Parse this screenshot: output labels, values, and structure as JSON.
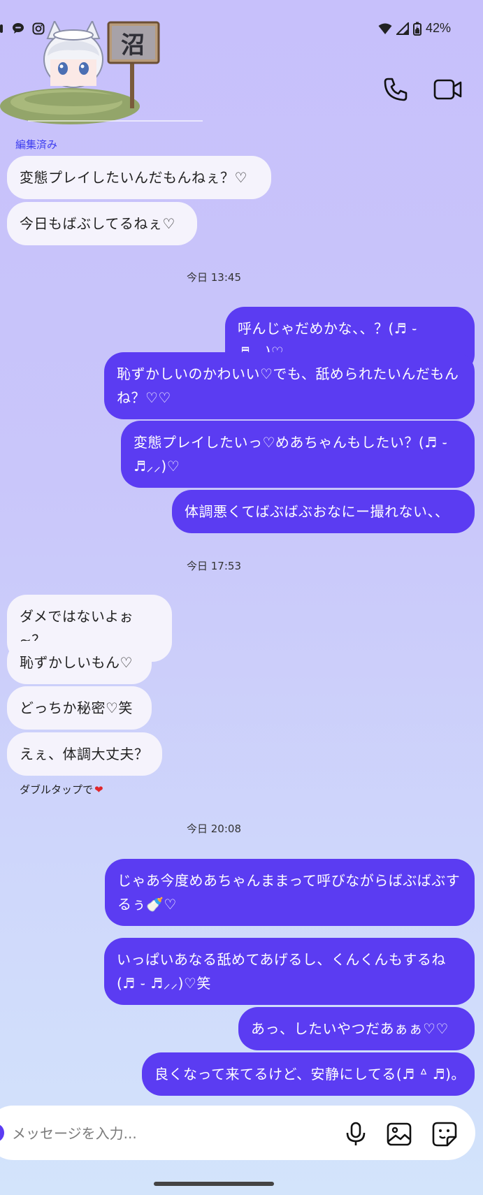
{
  "status_bar": {
    "battery": "42%"
  },
  "header": {
    "sticker_text": "沼"
  },
  "edited_label": "編集済み",
  "messages_block1": [
    {
      "text": "変態プレイしたいんだもんねぇ？♡"
    },
    {
      "text": "今日もばぶしてるねぇ♡"
    }
  ],
  "time1": "今日 13:45",
  "messages_block2": [
    {
      "text": "呼んじゃだめかな、、？(♬︎ ֊ ♬︎⸝⸝)♡"
    },
    {
      "text": "恥ずかしいのかわいい♡でも、舐められたいんだもんね？♡♡"
    },
    {
      "text": "変態プレイしたいっ♡めあちゃんもしたい？(♬︎ ֊ ♬︎⸝⸝)♡"
    },
    {
      "text": "体調悪くてばぶばぶおなにー撮れない、、"
    }
  ],
  "time2": "今日 17:53",
  "messages_block3": [
    {
      "text": "ダメではないよぉ~？"
    },
    {
      "text": "恥ずかしいもん♡"
    },
    {
      "text": "どっちか秘密♡笑"
    },
    {
      "text": "えぇ、体調大丈夫？"
    }
  ],
  "hint": {
    "text": "ダブルタップで",
    "heart": "❤"
  },
  "time3": "今日 20:08",
  "messages_block4": [
    {
      "text": "じゃあ今度めあちゃんままって呼びながらばぶばぶするぅ🍼♡"
    },
    {
      "text": "いっぱいあなる舐めてあげるし、くんくんもするね(♬︎ ֊ ♬︎⸝⸝)♡笑"
    },
    {
      "text": "あっ、したいやつだあぁぁ♡♡"
    },
    {
      "text": "良くなって来てるけど、安静にしてる(♬︎ ᐞ ♬︎)｡"
    }
  ],
  "input": {
    "placeholder": "メッセージを入力..."
  },
  "colors": {
    "accent": "#5b3cf2",
    "received_bg": "#f5f3fc",
    "edited_label": "#3d3df0"
  }
}
